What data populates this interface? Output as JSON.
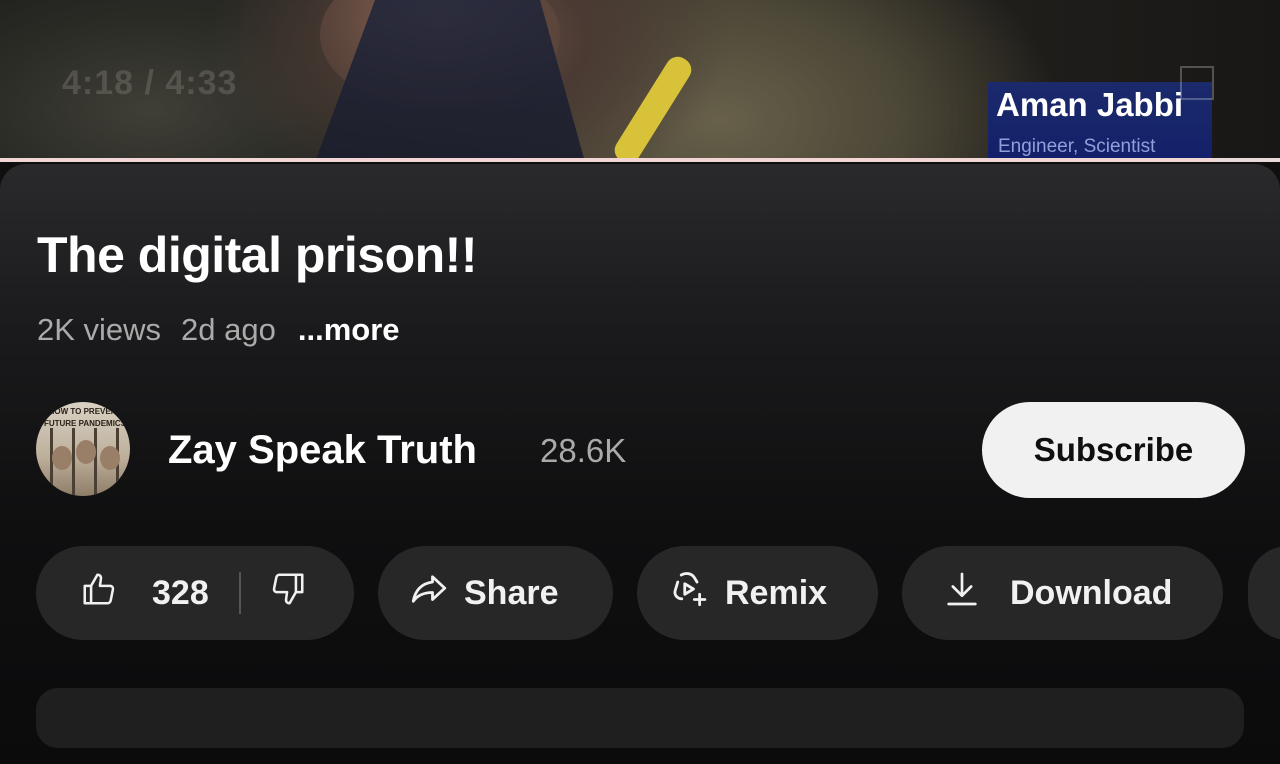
{
  "video": {
    "time_display": "4:18 / 4:33",
    "lower_third_name": "Aman Jabbi",
    "lower_third_role": "Engineer, Scientist",
    "progress_fraction": 0.948
  },
  "title": "The digital prison!!",
  "meta": {
    "views": "2K views",
    "age": "2d ago",
    "more_label": "...more"
  },
  "channel": {
    "name": "Zay Speak Truth",
    "subscribers": "28.6K",
    "avatar_text": "HOW TO PREVENT FUTURE PANDEMICS",
    "subscribe_label": "Subscribe"
  },
  "actions": {
    "like_count": "328",
    "share_label": "Share",
    "remix_label": "Remix",
    "download_label": "Download"
  },
  "colors": {
    "background": "#0f0f0f",
    "pill": "#272727",
    "subscribe_bg": "#f1f1f1",
    "lower_third": "#13206a"
  },
  "icons": [
    "thumbs-up-icon",
    "thumbs-down-icon",
    "share-arrow-icon",
    "remix-icon",
    "download-icon"
  ]
}
